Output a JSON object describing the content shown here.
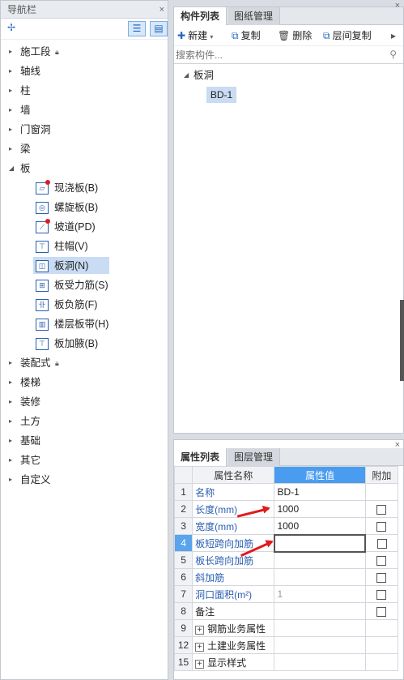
{
  "nav": {
    "title": "导航栏",
    "close": "×",
    "categories_top": [
      {
        "label": "施工段",
        "lock": true
      },
      {
        "label": "轴线"
      },
      {
        "label": "柱"
      },
      {
        "label": "墙"
      },
      {
        "label": "门窗洞"
      },
      {
        "label": "梁"
      }
    ],
    "expanded": {
      "label": "板"
    },
    "children": [
      {
        "label": "现浇板(B)",
        "icon": "slab-icon",
        "glyph": "▱",
        "dot": true
      },
      {
        "label": "螺旋板(B)",
        "icon": "spiral-slab-icon",
        "glyph": "◎",
        "dot": false
      },
      {
        "label": "坡道(PD)",
        "icon": "ramp-icon",
        "glyph": "⟋",
        "dot": true
      },
      {
        "label": "柱帽(V)",
        "icon": "column-cap-icon",
        "glyph": "⊤",
        "dot": false
      },
      {
        "label": "板洞(N)",
        "icon": "slab-hole-icon",
        "glyph": "◫",
        "dot": false,
        "selected": true
      },
      {
        "label": "板受力筋(S)",
        "icon": "rebar-icon",
        "glyph": "⊞",
        "dot": false
      },
      {
        "label": "板负筋(F)",
        "icon": "neg-rebar-icon",
        "glyph": "卝",
        "dot": false
      },
      {
        "label": "楼层板带(H)",
        "icon": "slab-strip-icon",
        "glyph": "▥",
        "dot": false
      },
      {
        "label": "板加腋(B)",
        "icon": "slab-haunch-icon",
        "glyph": "⊤",
        "dot": false
      }
    ],
    "categories_bottom": [
      {
        "label": "装配式",
        "lock": true
      },
      {
        "label": "楼梯"
      },
      {
        "label": "装修"
      },
      {
        "label": "土方"
      },
      {
        "label": "基础"
      },
      {
        "label": "其它"
      },
      {
        "label": "自定义"
      }
    ]
  },
  "component": {
    "tabs": [
      "构件列表",
      "图纸管理"
    ],
    "toolbar": {
      "new": "新建",
      "copy": "复制",
      "delete": "删除",
      "floor_copy": "层间复制"
    },
    "search_placeholder": "搜索构件...",
    "group": "板洞",
    "items": [
      "BD-1"
    ]
  },
  "properties": {
    "tabs": [
      "属性列表",
      "图层管理"
    ],
    "headers": [
      "属性名称",
      "属性值",
      "附加"
    ],
    "rows": [
      {
        "num": "1",
        "name": "名称",
        "value": "BD-1",
        "checkbox": false,
        "style": "link"
      },
      {
        "num": "2",
        "name": "长度(mm)",
        "value": "1000",
        "checkbox": true,
        "style": "link"
      },
      {
        "num": "3",
        "name": "宽度(mm)",
        "value": "1000",
        "checkbox": true,
        "style": "link"
      },
      {
        "num": "4",
        "name": "板短跨向加筋",
        "value": "",
        "checkbox": true,
        "style": "link",
        "active": true
      },
      {
        "num": "5",
        "name": "板长跨向加筋",
        "value": "",
        "checkbox": true,
        "style": "link"
      },
      {
        "num": "6",
        "name": "斜加筋",
        "value": "",
        "checkbox": true,
        "style": "link"
      },
      {
        "num": "7",
        "name": "洞口面积(m²)",
        "value": "1",
        "checkbox": true,
        "style": "link",
        "gray": true
      },
      {
        "num": "8",
        "name": "备注",
        "value": "",
        "checkbox": true,
        "style": "plain"
      },
      {
        "num": "9",
        "name": "钢筋业务属性",
        "value": "",
        "checkbox": false,
        "style": "group"
      },
      {
        "num": "12",
        "name": "土建业务属性",
        "value": "",
        "checkbox": false,
        "style": "group"
      },
      {
        "num": "15",
        "name": "显示样式",
        "value": "",
        "checkbox": false,
        "style": "group"
      }
    ]
  },
  "colors": {
    "accent": "#4a9cf0",
    "link": "#2a5fb0",
    "annotation": "#e01b1b"
  }
}
